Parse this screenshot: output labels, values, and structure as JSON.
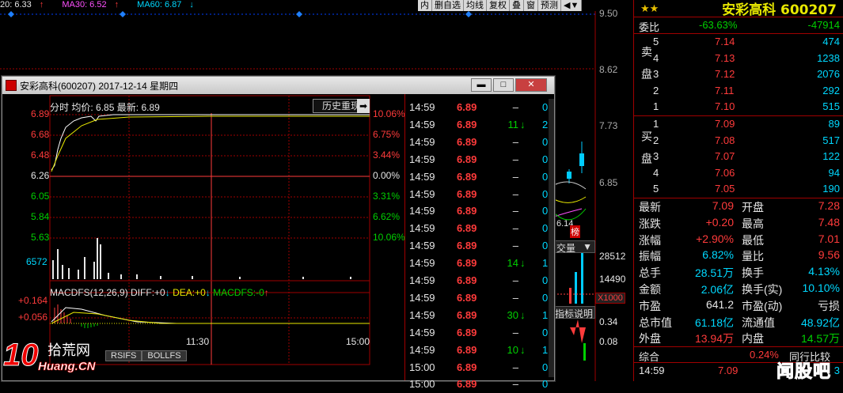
{
  "ma_bar": {
    "ma20": "20: 6.33",
    "ma20_arrow": "↑",
    "ma30": "MA30: 6.52",
    "ma30_arrow": "↑",
    "ma60": "MA60: 6.87",
    "ma60_arrow": "↓"
  },
  "toolbar": [
    "内",
    "删自选",
    "均线",
    "复权",
    "叠",
    "窗",
    "预测",
    "◀▼"
  ],
  "bg_chart": {
    "prices": [
      "9.50",
      "8.62",
      "7.73",
      "6.85"
    ],
    "vols": [
      "28512",
      "14490"
    ],
    "x1000": "X1000",
    "vol_label": "交量",
    "ind_label": "指标说明",
    "ind_vals": [
      "0.34",
      "0.08"
    ],
    "note": "6.14",
    "tag": "榜"
  },
  "quote": {
    "title": "安彩高科 600207",
    "weibi_label": "委比",
    "weibi_pct": "-63.63%",
    "weibi_num": "-47914",
    "sell_label": "卖盘",
    "buy_label": "买盘",
    "sell": [
      {
        "n": "5",
        "p": "7.14",
        "v": "474"
      },
      {
        "n": "4",
        "p": "7.13",
        "v": "1238"
      },
      {
        "n": "3",
        "p": "7.12",
        "v": "2076"
      },
      {
        "n": "2",
        "p": "7.11",
        "v": "292"
      },
      {
        "n": "1",
        "p": "7.10",
        "v": "515"
      }
    ],
    "buy": [
      {
        "n": "1",
        "p": "7.09",
        "v": "89"
      },
      {
        "n": "2",
        "p": "7.08",
        "v": "517"
      },
      {
        "n": "3",
        "p": "7.07",
        "v": "122"
      },
      {
        "n": "4",
        "p": "7.06",
        "v": "94"
      },
      {
        "n": "5",
        "p": "7.05",
        "v": "190"
      }
    ],
    "stats": [
      {
        "l1": "最新",
        "v1": "7.09",
        "c1": "red",
        "l2": "开盘",
        "v2": "7.28",
        "c2": "red"
      },
      {
        "l1": "涨跌",
        "v1": "+0.20",
        "c1": "red",
        "l2": "最高",
        "v2": "7.48",
        "c2": "red"
      },
      {
        "l1": "涨幅",
        "v1": "+2.90%",
        "c1": "red",
        "l2": "最低",
        "v2": "7.01",
        "c2": "red"
      },
      {
        "l1": "振幅",
        "v1": "6.82%",
        "c1": "cyn",
        "l2": "量比",
        "v2": "9.56",
        "c2": "red"
      },
      {
        "l1": "总手",
        "v1": "28.51万",
        "c1": "cyn",
        "l2": "换手",
        "v2": "4.13%",
        "c2": "cyn"
      },
      {
        "l1": "金额",
        "v1": "2.06亿",
        "c1": "cyn",
        "l2": "换手(实)",
        "v2": "10.10%",
        "c2": "cyn"
      },
      {
        "l1": "市盈",
        "v1": "641.2",
        "c1": "wht",
        "l2": "市盈(动)",
        "v2": "亏损",
        "c2": "wht"
      },
      {
        "l1": "总市值",
        "v1": "61.18亿",
        "c1": "cyn",
        "l2": "流通值",
        "v2": "48.92亿",
        "c2": "cyn"
      },
      {
        "l1": "外盘",
        "v1": "13.94万",
        "c1": "red",
        "l2": "内盘",
        "v2": "14.57万",
        "c2": "grn"
      }
    ],
    "zonghe": "综合",
    "zonghe_pct": "0.24%",
    "zonghe_extra": "同行比较",
    "last_time": "14:59",
    "last_price": "7.09",
    "last_vol": "3",
    "watermark": "闻股吧"
  },
  "popup": {
    "title": "安彩高科(600207) 2017-12-14 星期四",
    "btn_min": "▬",
    "btn_max": "□",
    "btn_close": "✕",
    "header": {
      "label1": "分时",
      "label2": "均价:",
      "avg": "6.85",
      "label3": "最新:",
      "last": "6.89",
      "history_btn": "历史重现",
      "arrow": "➡"
    },
    "left_axis": [
      "6.89",
      "6.68",
      "6.48",
      "6.26",
      "6.05",
      "5.84",
      "5.63"
    ],
    "right_axis": [
      "10.06%",
      "6.75%",
      "3.44%",
      "0.00%",
      "3.31%",
      "6.62%",
      "10.06%"
    ],
    "vol_label": "6572",
    "macd": {
      "name": "MACDFS(12,26,9)",
      "diff_l": "DIFF:",
      "diff": "+0",
      "dea_l": "DEA:",
      "dea": "+0",
      "macdfs_l": "MACDFS:",
      "macdfs": "-0",
      "y1": "+0.164",
      "y2": "+0.056"
    },
    "times": [
      "11:30",
      "15:00"
    ],
    "bottom_tabs": [
      "RSIFS",
      "BOLLFS"
    ],
    "ticks": [
      {
        "t": "14:59",
        "p": "6.89",
        "v": "–",
        "a": "",
        "n": "0"
      },
      {
        "t": "14:59",
        "p": "6.89",
        "v": "11",
        "a": "↓",
        "n": "2"
      },
      {
        "t": "14:59",
        "p": "6.89",
        "v": "–",
        "a": "",
        "n": "0"
      },
      {
        "t": "14:59",
        "p": "6.89",
        "v": "–",
        "a": "",
        "n": "0"
      },
      {
        "t": "14:59",
        "p": "6.89",
        "v": "–",
        "a": "",
        "n": "0"
      },
      {
        "t": "14:59",
        "p": "6.89",
        "v": "–",
        "a": "",
        "n": "0"
      },
      {
        "t": "14:59",
        "p": "6.89",
        "v": "–",
        "a": "",
        "n": "0"
      },
      {
        "t": "14:59",
        "p": "6.89",
        "v": "–",
        "a": "",
        "n": "0"
      },
      {
        "t": "14:59",
        "p": "6.89",
        "v": "–",
        "a": "",
        "n": "0"
      },
      {
        "t": "14:59",
        "p": "6.89",
        "v": "14",
        "a": "↓",
        "n": "1"
      },
      {
        "t": "14:59",
        "p": "6.89",
        "v": "–",
        "a": "",
        "n": "0"
      },
      {
        "t": "14:59",
        "p": "6.89",
        "v": "–",
        "a": "",
        "n": "0"
      },
      {
        "t": "14:59",
        "p": "6.89",
        "v": "30",
        "a": "↓",
        "n": "1"
      },
      {
        "t": "14:59",
        "p": "6.89",
        "v": "–",
        "a": "",
        "n": "0"
      },
      {
        "t": "14:59",
        "p": "6.89",
        "v": "10",
        "a": "↓",
        "n": "1"
      },
      {
        "t": "15:00",
        "p": "6.89",
        "v": "–",
        "a": "",
        "n": "0"
      },
      {
        "t": "15:00",
        "p": "6.89",
        "v": "–",
        "a": "",
        "n": "0"
      }
    ]
  },
  "logo": {
    "big": "10",
    "mid": "拾荒网",
    "sub": "Huang.CN"
  },
  "colors": {
    "up": "#ff3b3b",
    "down": "#00d000",
    "accent": "#e8e800",
    "grid": "#a00000"
  }
}
